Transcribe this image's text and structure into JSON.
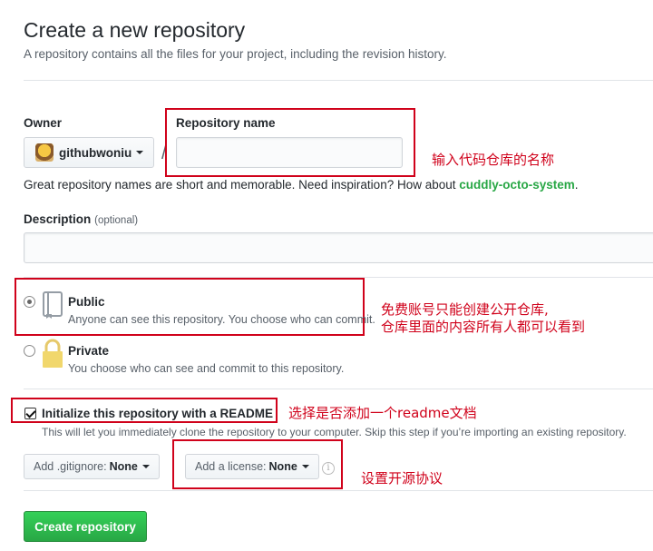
{
  "header": {
    "title": "Create a new repository",
    "subtitle": "A repository contains all the files for your project, including the revision history."
  },
  "owner": {
    "label": "Owner",
    "username": "githubwoniu"
  },
  "slash": "/",
  "repo_name": {
    "label": "Repository name",
    "value": "",
    "hint_prefix": "Great repository names are short and memorable. Need inspiration? How about ",
    "suggestion": "cuddly-octo-system",
    "hint_suffix": "."
  },
  "description": {
    "label": "Description",
    "optional": "(optional)",
    "value": ""
  },
  "visibility": {
    "public": {
      "label": "Public",
      "desc": "Anyone can see this repository. You choose who can commit.",
      "selected": true
    },
    "private": {
      "label": "Private",
      "desc": "You choose who can see and commit to this repository.",
      "selected": false
    }
  },
  "readme": {
    "label": "Initialize this repository with a README",
    "desc": "This will let you immediately clone the repository to your computer. Skip this step if you’re importing an existing repository.",
    "checked": true
  },
  "gitignore": {
    "prefix": "Add .gitignore:",
    "value": "None"
  },
  "license": {
    "prefix": "Add a license:",
    "value": "None"
  },
  "create_button": "Create repository",
  "annotations": {
    "name": "输入代码仓库的名称",
    "public_line1": "免费账号只能创建公开仓库,",
    "public_line2": "仓库里面的内容所有人都可以看到",
    "readme": "选择是否添加一个readme文档",
    "license": "设置开源协议"
  },
  "colors": {
    "annotation": "#d0021b",
    "primary_button": "#28a745",
    "suggestion": "#28a745"
  }
}
